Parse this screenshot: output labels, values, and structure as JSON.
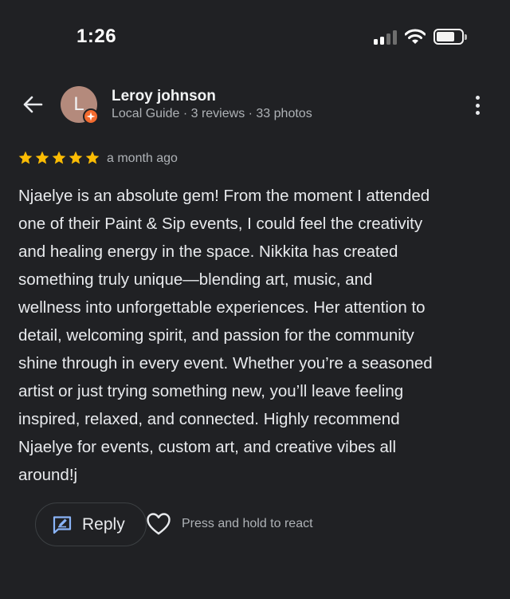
{
  "status_bar": {
    "time": "1:26"
  },
  "header": {
    "avatar_initial": "L",
    "reviewer_name": "Leroy johnson",
    "reviewer_meta": "Local Guide · 3 reviews · 33 photos"
  },
  "review": {
    "rating": 5,
    "rating_max": 5,
    "date": "a month ago",
    "text": "Njaelye is an absolute gem! From the moment I attended\none of their Paint & Sip events, I could feel the creativity\nand healing energy in the space. Nikkita has created\nsomething truly unique—blending art, music, and\nwellness into unforgettable experiences. Her attention to\ndetail, welcoming spirit, and passion for the community\nshine through in every event. Whether you’re a seasoned\nartist or just trying something new, you’ll leave feeling\ninspired, relaxed, and connected. Highly recommend\nNjaelye for events, custom art, and creative vibes all\naround!j"
  },
  "actions": {
    "reply_label": "Reply",
    "react_hint": "Press and hold to react"
  },
  "colors": {
    "background": "#202124",
    "star": "#fbbc04",
    "badge": "#f36b2f",
    "reply_icon": "#8ab4f8"
  }
}
